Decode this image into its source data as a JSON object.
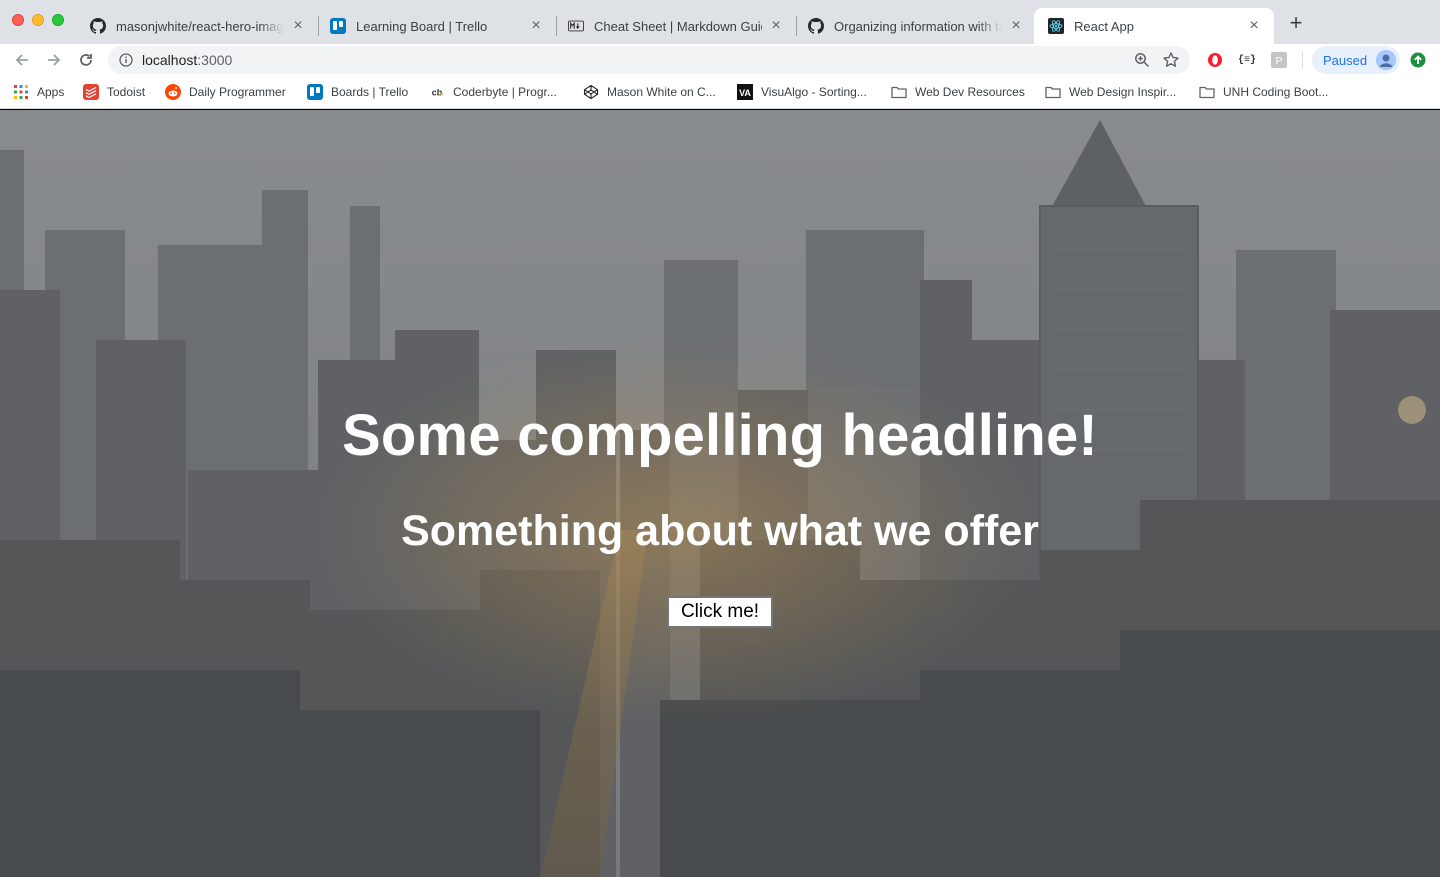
{
  "browser": {
    "tabs": [
      {
        "title": "masonjwhite/react-hero-image",
        "favicon": "github-icon",
        "active": false
      },
      {
        "title": "Learning Board | Trello",
        "favicon": "trello-icon",
        "active": false
      },
      {
        "title": "Cheat Sheet | Markdown Guide",
        "favicon": "markdown-icon",
        "active": false
      },
      {
        "title": "Organizing information with tab",
        "favicon": "github-icon",
        "active": false
      },
      {
        "title": "React App",
        "favicon": "react-icon",
        "active": true
      }
    ],
    "url": {
      "host": "localhost",
      "port": ":3000"
    },
    "profile_status": "Paused",
    "bookmarks": [
      {
        "label": "Apps",
        "icon": "apps-grid-icon"
      },
      {
        "label": "Todoist",
        "icon": "todoist-icon"
      },
      {
        "label": "Daily Programmer",
        "icon": "reddit-icon"
      },
      {
        "label": "Boards | Trello",
        "icon": "trello-icon"
      },
      {
        "label": "Coderbyte | Progr...",
        "icon": "coderbyte-icon"
      },
      {
        "label": "Mason White on C...",
        "icon": "codepen-icon"
      },
      {
        "label": "VisuAlgo - Sorting...",
        "icon": "visualgo-icon"
      },
      {
        "label": "Web Dev Resources",
        "icon": "folder-icon"
      },
      {
        "label": "Web Design Inspir...",
        "icon": "folder-icon"
      },
      {
        "label": "UNH Coding Boot...",
        "icon": "folder-icon"
      }
    ],
    "colors": {
      "tabstrip": "#dee1e6",
      "accent": "#1a73e8"
    }
  },
  "hero": {
    "headline": "Some compelling headline!",
    "subheadline": "Something about what we offer",
    "cta_label": "Click me!",
    "background": "city-skyline-photo"
  }
}
